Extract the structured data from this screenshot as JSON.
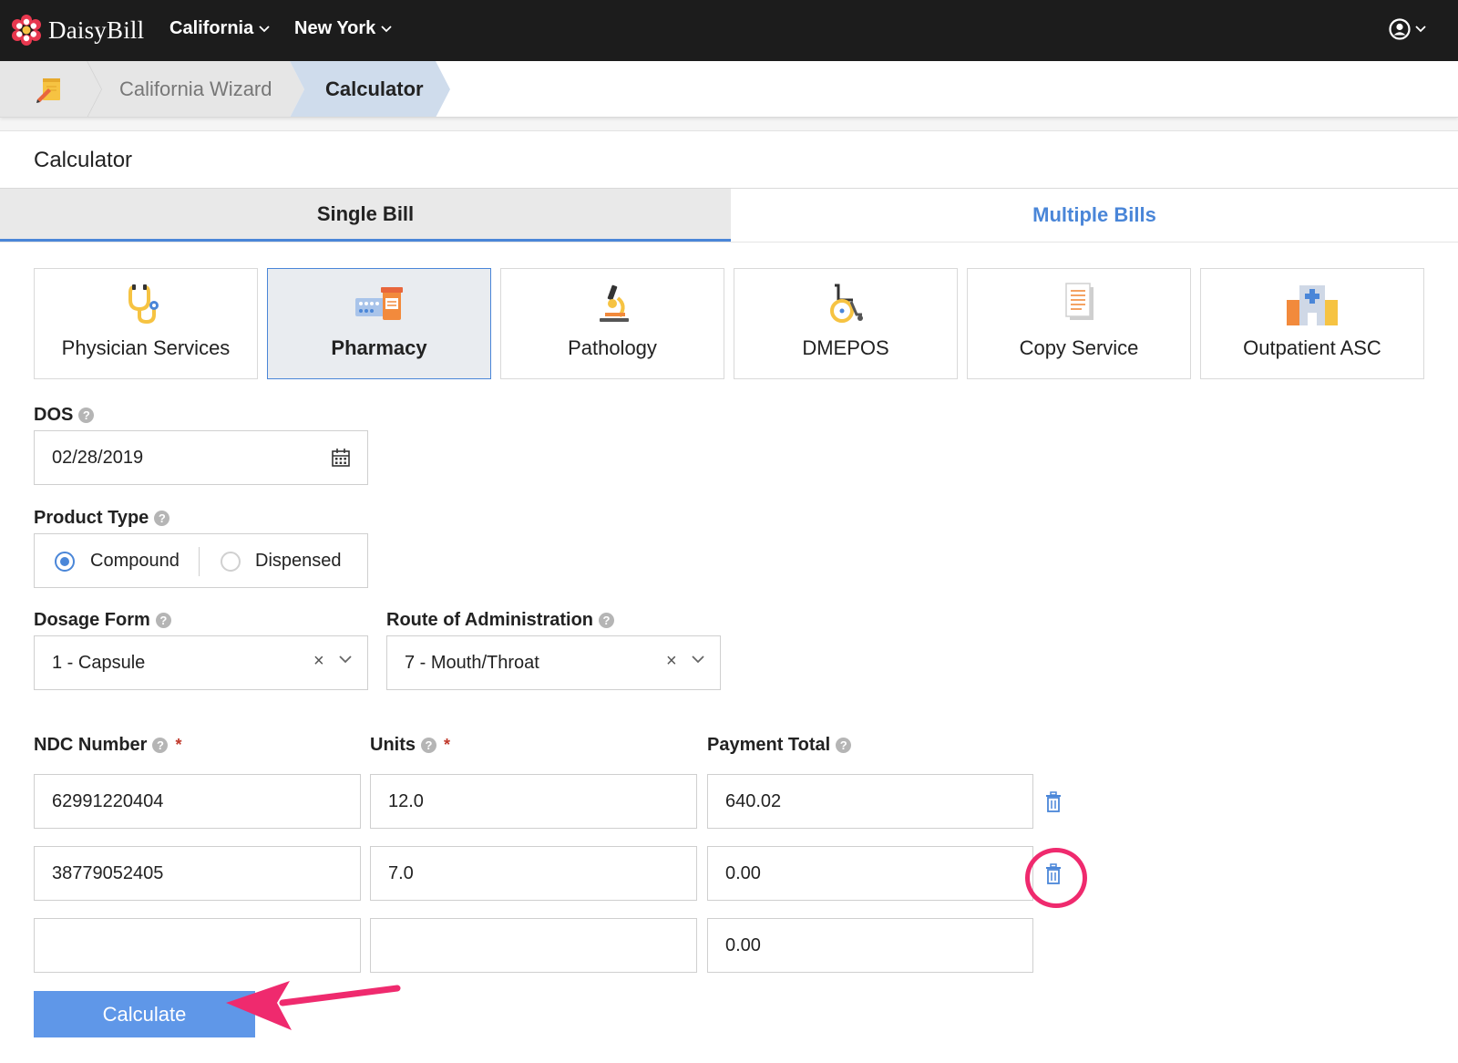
{
  "topnav": {
    "brand": "DaisyBill",
    "states": [
      {
        "label": "California"
      },
      {
        "label": "New York"
      }
    ]
  },
  "breadcrumb": {
    "items": [
      {
        "label": "California Wizard"
      },
      {
        "label": "Calculator"
      }
    ]
  },
  "page": {
    "title": "Calculator"
  },
  "tabs": [
    {
      "label": "Single Bill",
      "active": true
    },
    {
      "label": "Multiple Bills",
      "active": false
    }
  ],
  "services": [
    {
      "label": "Physician Services",
      "icon": "stethoscope-icon"
    },
    {
      "label": "Pharmacy",
      "icon": "pharmacy-icon",
      "selected": true
    },
    {
      "label": "Pathology",
      "icon": "microscope-icon"
    },
    {
      "label": "DMEPOS",
      "icon": "wheelchair-icon"
    },
    {
      "label": "Copy Service",
      "icon": "document-icon"
    },
    {
      "label": "Outpatient ASC",
      "icon": "hospital-icon"
    }
  ],
  "form": {
    "dos": {
      "label": "DOS",
      "value": "02/28/2019"
    },
    "product_type": {
      "label": "Product Type",
      "options": [
        "Compound",
        "Dispensed"
      ],
      "selected": "Compound"
    },
    "dosage_form": {
      "label": "Dosage Form",
      "value": "1 - Capsule"
    },
    "route": {
      "label": "Route of Administration",
      "value": "7 - Mouth/Throat"
    },
    "columns": {
      "ndc": "NDC Number",
      "units": "Units",
      "payment": "Payment Total"
    },
    "required_marker": "*",
    "rows": [
      {
        "ndc": "62991220404",
        "units": "12.0",
        "payment": "640.02"
      },
      {
        "ndc": "38779052405",
        "units": "7.0",
        "payment": "0.00"
      },
      {
        "ndc": "",
        "units": "",
        "payment": "0.00"
      }
    ],
    "calculate_label": "Calculate"
  },
  "colors": {
    "accent": "#4a86d8",
    "button": "#5f97e8",
    "annotation": "#ef2a6e",
    "navbar": "#1c1c1c"
  }
}
